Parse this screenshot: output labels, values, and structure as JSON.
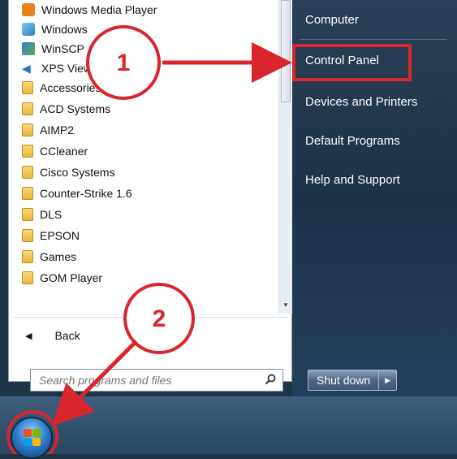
{
  "programs": [
    {
      "label": "Windows Media Player",
      "icon": "media-player-icon"
    },
    {
      "label": "Windows",
      "icon": "windows-app-icon"
    },
    {
      "label": "WinSCP",
      "icon": "winscp-icon"
    },
    {
      "label": "XPS Viewer",
      "icon": "xps-viewer-icon"
    },
    {
      "label": "Accessories",
      "icon": "folder-icon"
    },
    {
      "label": "ACD Systems",
      "icon": "folder-icon"
    },
    {
      "label": "AIMP2",
      "icon": "folder-icon"
    },
    {
      "label": "CCleaner",
      "icon": "folder-icon"
    },
    {
      "label": "Cisco Systems",
      "icon": "folder-icon"
    },
    {
      "label": "Counter-Strike 1.6",
      "icon": "folder-icon"
    },
    {
      "label": "DLS",
      "icon": "folder-icon"
    },
    {
      "label": "EPSON",
      "icon": "folder-icon"
    },
    {
      "label": "Games",
      "icon": "folder-icon"
    },
    {
      "label": "GOM Player",
      "icon": "folder-icon"
    }
  ],
  "back_label": "Back",
  "search": {
    "placeholder": "Search programs and files"
  },
  "right_items": [
    "Computer",
    "Control Panel",
    "Devices and Printers",
    "Default Programs",
    "Help and Support"
  ],
  "shutdown_label": "Shut down",
  "annotations": {
    "step1": "1",
    "step2": "2"
  },
  "colors": {
    "annotation_red": "#d8262c",
    "menu_right_bg": "#1d3247",
    "taskbar": "#2a4661"
  }
}
